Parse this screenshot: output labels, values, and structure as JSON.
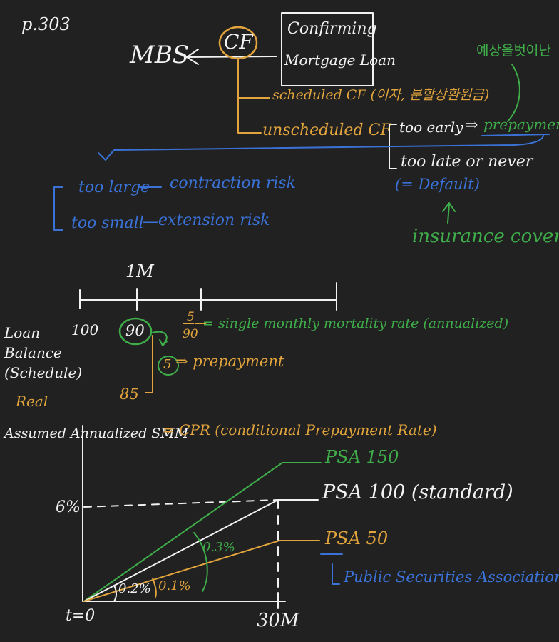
{
  "page_ref": "p.303",
  "flow": {
    "mbs": "MBS",
    "cf": "CF",
    "loan_box": [
      "Confirming",
      "Mortgage Loan"
    ],
    "scheduled_cf": "scheduled CF (이자, 분할상환원금)",
    "unscheduled_cf": "unscheduled CF",
    "too_early": "too early",
    "prepayment": "prepayment",
    "too_late": "too late or never",
    "default": "(= Default)",
    "insurance": "insurance cover",
    "unexpected": "예상을벗어난"
  },
  "risks": {
    "large": "too large",
    "contraction": "contraction risk",
    "small": "too small",
    "extension": "extension risk"
  },
  "balance": {
    "tick_1m": "1M",
    "start": "100",
    "scheduled": "90",
    "real": "85",
    "prepay_amount": "5",
    "ratio_num": "5",
    "ratio_den": "90",
    "smm_def": "= single monthly mortality rate (annualized)",
    "prepay_label": "⇒ prepayment",
    "row_label": [
      "Loan",
      "Balance",
      "(Schedule)"
    ],
    "real_label": "Real"
  },
  "psa": {
    "title_left": "Assumed Annualized SMM",
    "title_right": "= CPR (conditional Prepayment Rate)",
    "y_label": "6%",
    "x_start": "t=0",
    "x_end": "30M",
    "psa150": "PSA 150",
    "psa100": "PSA 100 (standard)",
    "psa50": "PSA 50",
    "slope_02": "0.2%",
    "slope_01": "0.1%",
    "slope_03": "0.3%",
    "psa_full": "Public Securities Association"
  },
  "chart_data": {
    "type": "line",
    "title": "Assumed Annualized SMM = CPR (conditional Prepayment Rate)",
    "xlabel": "",
    "ylabel": "",
    "x": [
      0,
      30
    ],
    "x_tick_labels": [
      "t=0",
      "30M"
    ],
    "y_tick_labels": [
      "6%"
    ],
    "xlim": [
      0,
      30
    ],
    "ylim": [
      0,
      9
    ],
    "series": [
      {
        "name": "PSA 150",
        "values": [
          0,
          9
        ],
        "color": "#3fae4a"
      },
      {
        "name": "PSA 100 (standard)",
        "values": [
          0,
          6
        ],
        "color": "#f2f2f2"
      },
      {
        "name": "PSA 50",
        "values": [
          0,
          3
        ],
        "color": "#e2a43c"
      }
    ]
  }
}
